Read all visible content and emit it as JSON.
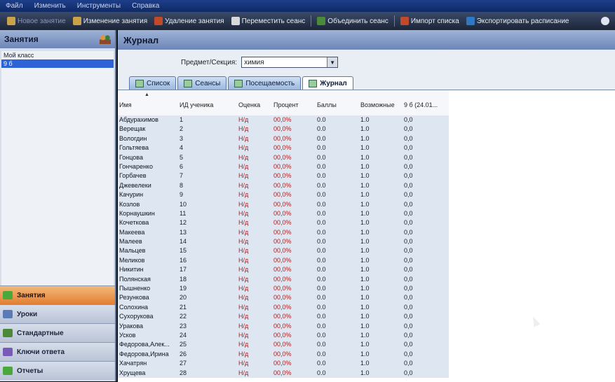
{
  "menu": [
    "Файл",
    "Изменить",
    "Инструменты",
    "Справка"
  ],
  "toolbar": [
    {
      "label": "Новое занятие",
      "icon": "new-lesson-icon",
      "color": "#c9a24a",
      "dim": true
    },
    {
      "label": "Изменение занятия",
      "icon": "edit-lesson-icon",
      "color": "#c9a24a"
    },
    {
      "label": "Удаление занятия",
      "icon": "delete-lesson-icon",
      "color": "#c24a2a"
    },
    {
      "label": "Переместить сеанс",
      "icon": "move-session-icon",
      "color": "#d8d8d8"
    },
    {
      "label": "Объединить сеанс",
      "icon": "merge-session-icon",
      "color": "#4a8a3a"
    },
    {
      "label": "Импорт списка",
      "icon": "import-list-icon",
      "color": "#c24a2a"
    },
    {
      "label": "Экспортировать расписание",
      "icon": "export-schedule-icon",
      "color": "#2f79c4"
    }
  ],
  "sidebar": {
    "title": "Занятия",
    "classes": [
      {
        "label": "Мой класс",
        "selected": false
      },
      {
        "label": "9 б",
        "selected": true
      }
    ],
    "nav": [
      {
        "label": "Занятия",
        "active": true,
        "color": "#4aa83a"
      },
      {
        "label": "Уроки",
        "active": false,
        "color": "#5a7ab8"
      },
      {
        "label": "Стандартные",
        "active": false,
        "color": "#4a8a3a"
      },
      {
        "label": "Ключи ответа",
        "active": false,
        "color": "#7a5ab8"
      },
      {
        "label": "Отчеты",
        "active": false,
        "color": "#4aa83a"
      }
    ]
  },
  "main": {
    "title": "Журнал",
    "subject_label": "Предмет/Секция:",
    "subject_value": "химия",
    "tabs": [
      {
        "label": "Список",
        "active": false
      },
      {
        "label": "Сеансы",
        "active": false
      },
      {
        "label": "Посещаемость",
        "active": false
      },
      {
        "label": "Журнал",
        "active": true
      }
    ],
    "columns": [
      "Имя",
      "ИД ученика",
      "Оценка",
      "Процент",
      "Баллы",
      "Возможные",
      "9 б (24.01..."
    ],
    "rows": [
      [
        "Абдурахимов",
        "1"
      ],
      [
        "Верещак",
        "2"
      ],
      [
        "Вологдин",
        "3"
      ],
      [
        "Гольтяева",
        "4"
      ],
      [
        "Гонцова",
        "5"
      ],
      [
        "Гончаренко",
        "6"
      ],
      [
        "Горбачев",
        "7"
      ],
      [
        "Джевелеки",
        "8"
      ],
      [
        "Качурин",
        "9"
      ],
      [
        "Козлов",
        "10"
      ],
      [
        "Корнаушкин",
        "11"
      ],
      [
        "Кочеткова",
        "12"
      ],
      [
        "Макеева",
        "13"
      ],
      [
        "Малеев",
        "14"
      ],
      [
        "Мальцев",
        "15"
      ],
      [
        "Меликов",
        "16"
      ],
      [
        "Никитин",
        "17"
      ],
      [
        "Полянская",
        "18"
      ],
      [
        "Пышненко",
        "19"
      ],
      [
        "Резункова",
        "20"
      ],
      [
        "Солохина",
        "21"
      ],
      [
        "Сухорукова",
        "22"
      ],
      [
        "Уракова",
        "23"
      ],
      [
        "Усков",
        "24"
      ],
      [
        "Федорова,Алек...",
        "25"
      ],
      [
        "Федорова,Ирина",
        "26"
      ],
      [
        "Хачатрян",
        "27"
      ],
      [
        "Хрущева",
        "28"
      ]
    ],
    "grade": "Н/д",
    "percent": "00,0%",
    "points": "0.0",
    "possible": "1.0",
    "session_score": "0,0"
  }
}
